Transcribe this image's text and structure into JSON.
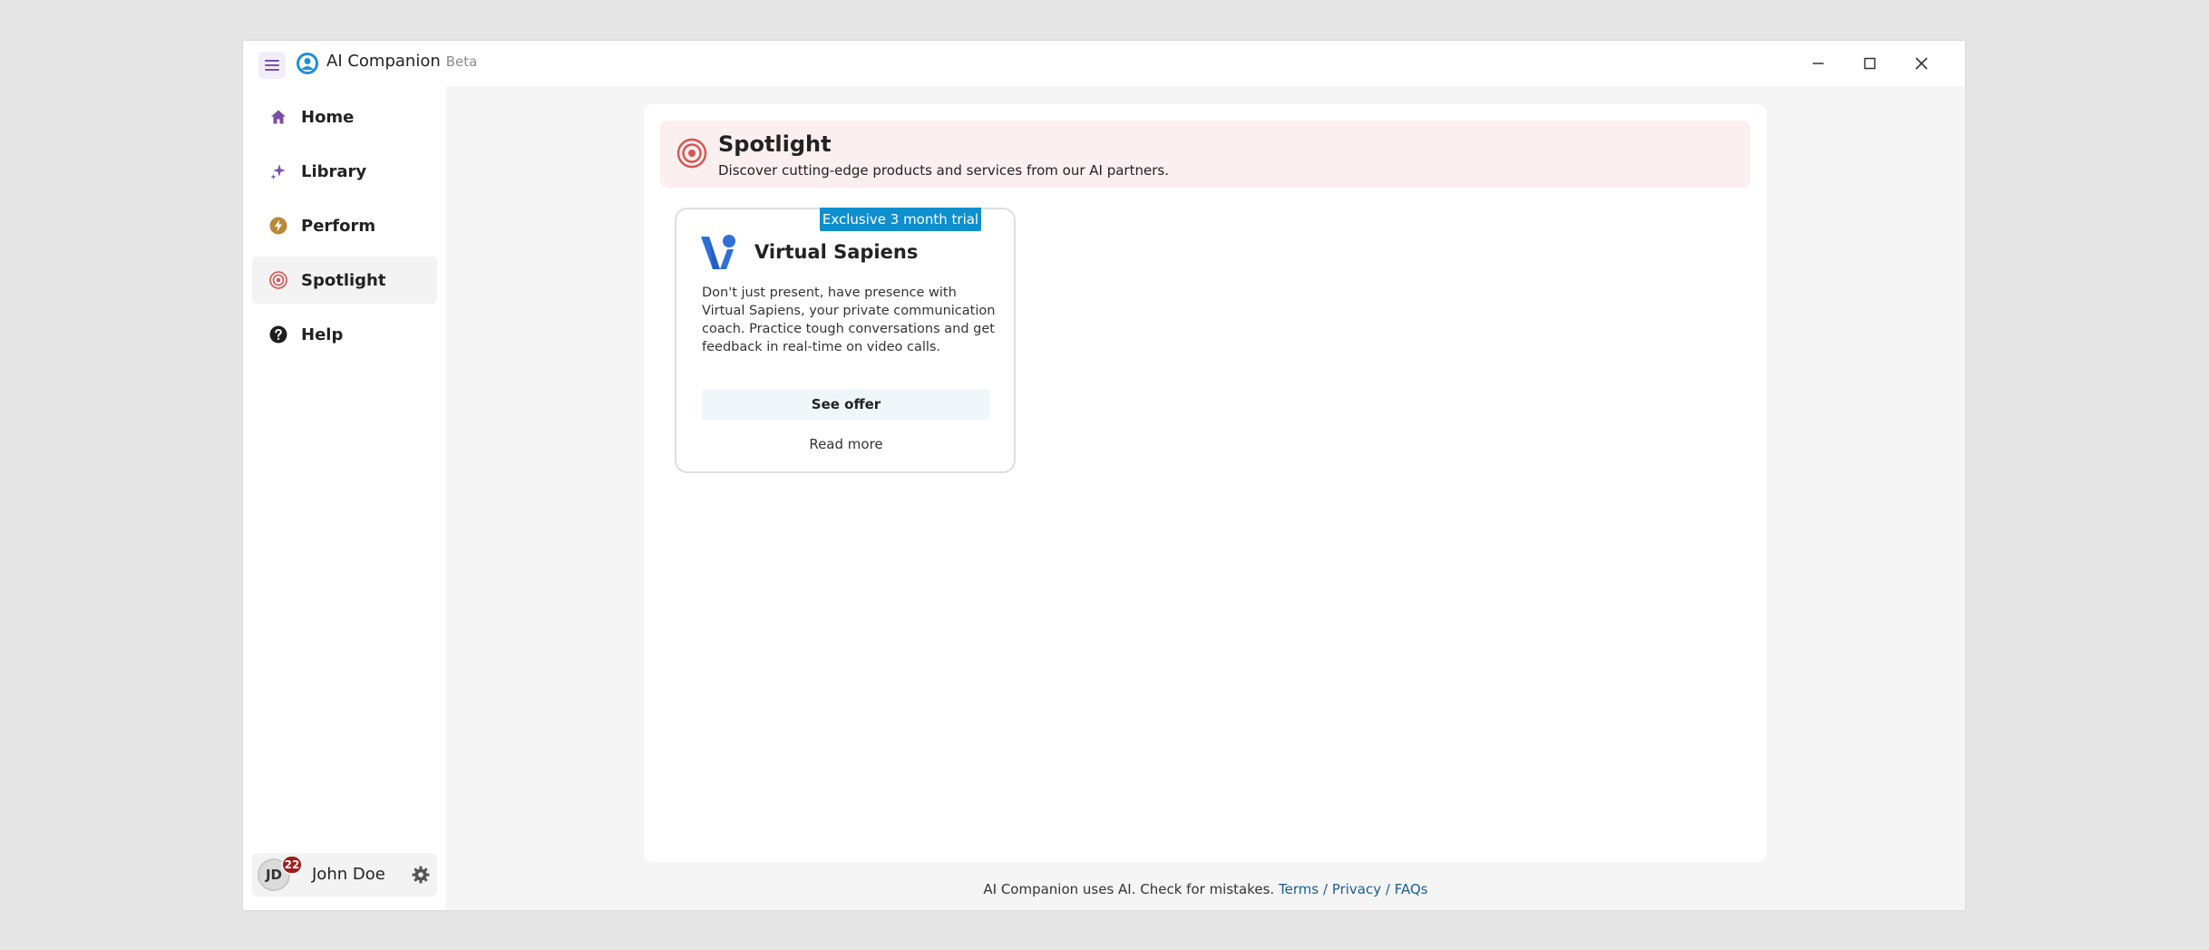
{
  "app": {
    "title": "AI Companion",
    "beta_label": "Beta"
  },
  "sidebar": {
    "items": [
      {
        "label": "Home",
        "icon": "home-icon",
        "active": false
      },
      {
        "label": "Library",
        "icon": "sparkle-icon",
        "active": false
      },
      {
        "label": "Perform",
        "icon": "lightning-icon",
        "active": false
      },
      {
        "label": "Spotlight",
        "icon": "target-icon",
        "active": true
      },
      {
        "label": "Help",
        "icon": "help-icon",
        "active": false
      }
    ]
  },
  "user": {
    "initials": "JD",
    "name": "John Doe",
    "notification_count": "22"
  },
  "spotlight": {
    "title": "Spotlight",
    "subtitle": "Discover cutting-edge products and services from our AI partners."
  },
  "offer": {
    "tag": "Exclusive 3 month trial",
    "partner_name": "Virtual Sapiens",
    "description": "Don't just present, have presence with Virtual Sapiens, your private communication coach. Practice tough conversations and get feedback in real-time on video calls.",
    "primary_button": "See offer",
    "secondary_button": "Read more"
  },
  "footer": {
    "text": "AI Companion uses AI. Check for mistakes.",
    "links": [
      "Terms",
      "Privacy",
      "FAQs"
    ],
    "separator": "/"
  },
  "colors": {
    "accent_purple": "#7b4fa8",
    "spotlight_red": "#d9534f",
    "tag_blue": "#0e8fce",
    "link_blue": "#1b5e8d",
    "badge_red": "#a11d1d"
  }
}
